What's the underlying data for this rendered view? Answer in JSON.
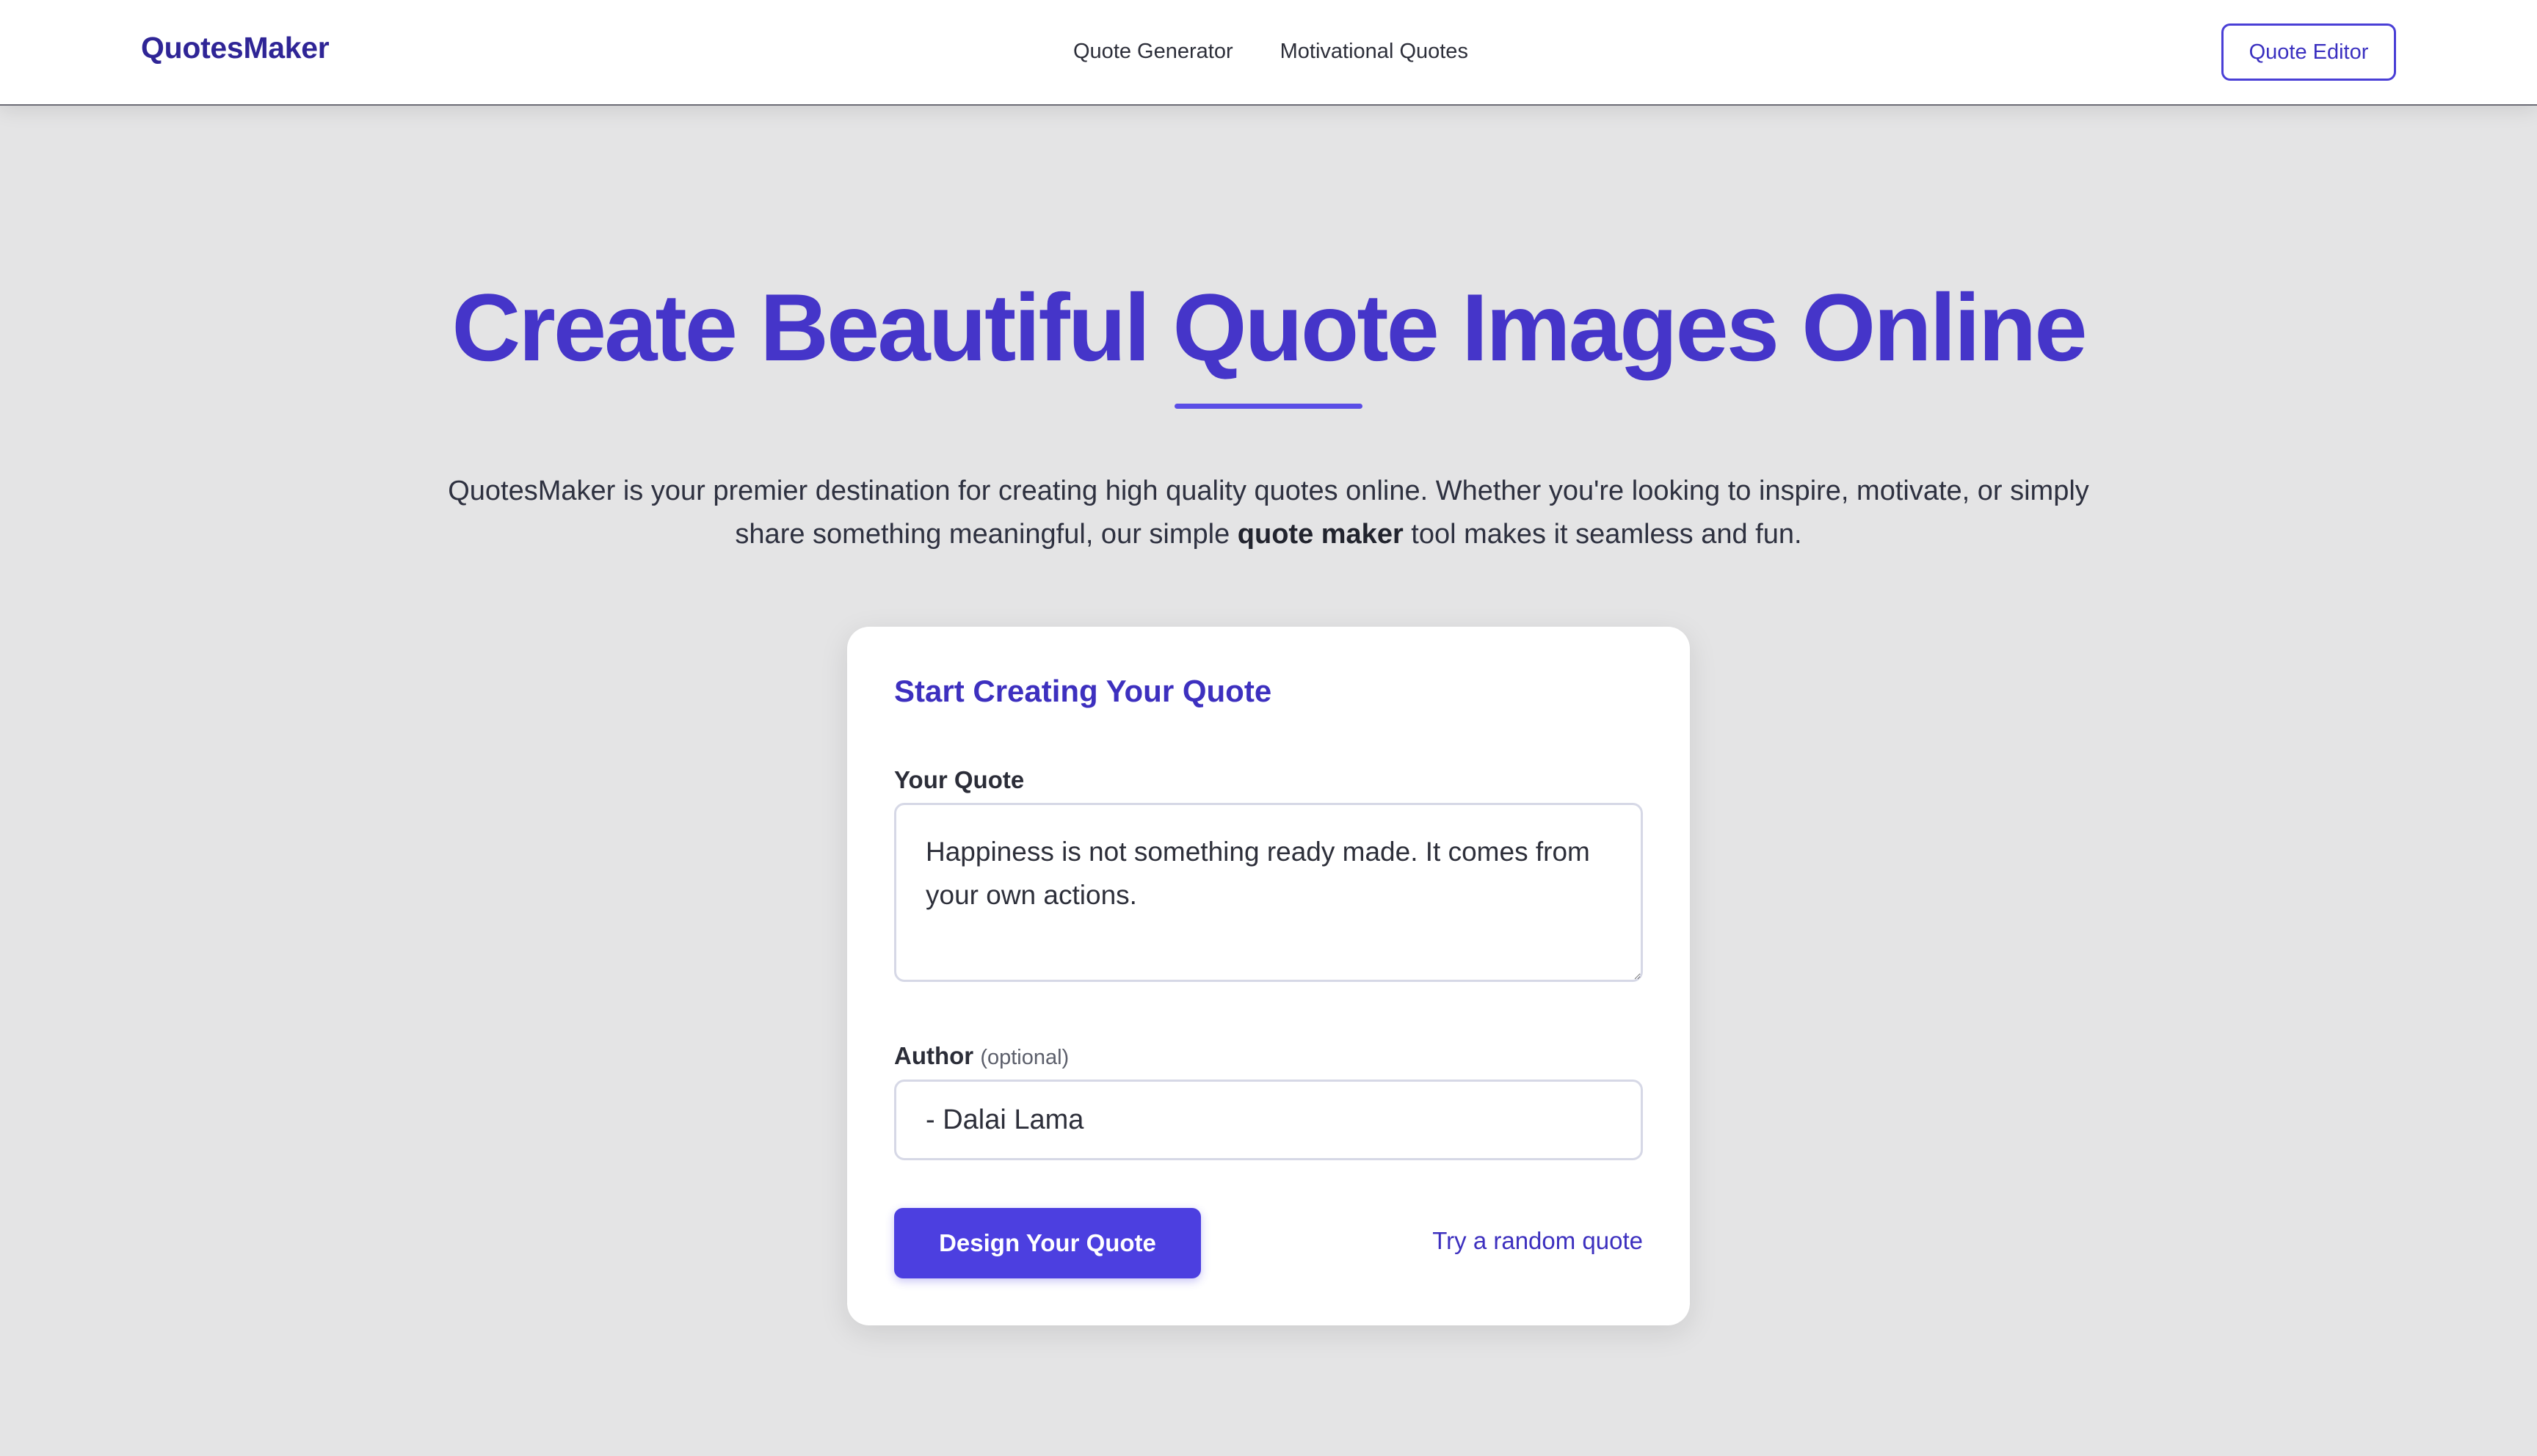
{
  "header": {
    "logo": "QuotesMaker",
    "nav": [
      {
        "label": "Quote Generator"
      },
      {
        "label": "Motivational Quotes"
      }
    ],
    "editor_button": "Quote Editor"
  },
  "hero": {
    "title": "Create Beautiful Quote Images Online",
    "desc_before": "QuotesMaker is your premier destination for creating high quality quotes online. Whether you're looking to inspire, motivate, or simply share something meaningful, our simple ",
    "desc_bold": "quote maker",
    "desc_after": " tool makes it seamless and fun."
  },
  "card": {
    "title": "Start Creating Your Quote",
    "quote_label": "Your Quote",
    "quote_value": "Happiness is not something ready made. It comes from your own actions.",
    "author_label": "Author",
    "author_optional": "(optional)",
    "author_value": "- Dalai Lama",
    "design_button": "Design Your Quote",
    "random_link": "Try a random quote"
  },
  "colors": {
    "brand": "#4535c9",
    "button": "#4c3fe0",
    "background": "#e4e4e5"
  }
}
